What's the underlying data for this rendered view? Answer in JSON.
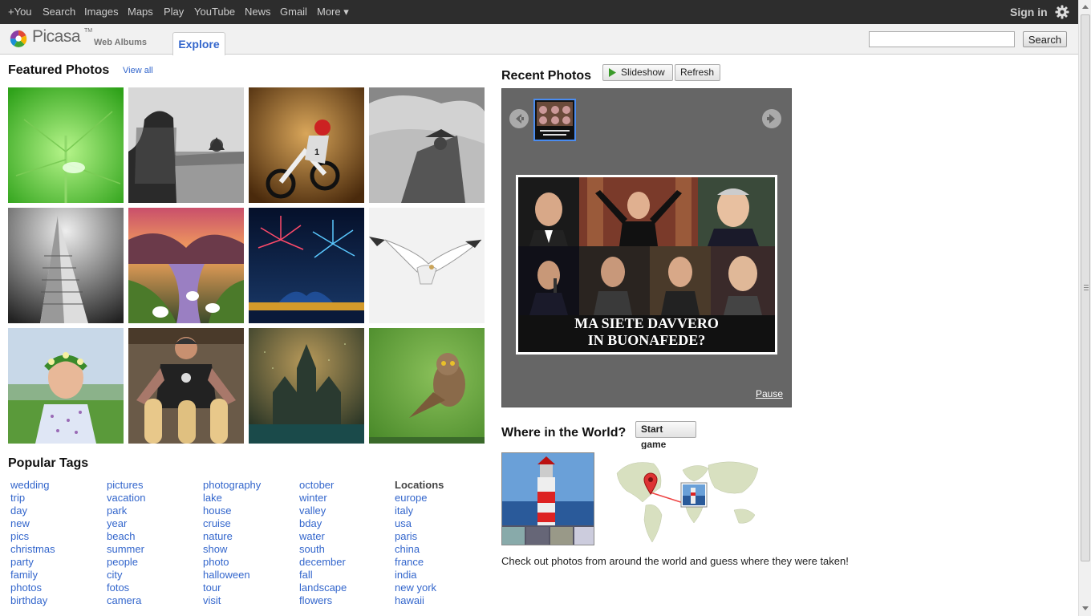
{
  "topbar": {
    "links": [
      "+You",
      "Search",
      "Images",
      "Maps",
      "Play",
      "YouTube",
      "News",
      "Gmail",
      "More ▾"
    ],
    "signin": "Sign in"
  },
  "header": {
    "logo": "Picasa",
    "logo_tm": "TM",
    "subtitle": "Web Albums",
    "tab": "Explore",
    "search_value": "",
    "search_button": "Search"
  },
  "featured": {
    "title": "Featured Photos",
    "view_all": "View all"
  },
  "tags": {
    "title": "Popular Tags",
    "col1": [
      "wedding",
      "trip",
      "day",
      "new",
      "pics",
      "christmas",
      "party",
      "family",
      "photos",
      "birthday"
    ],
    "col2": [
      "pictures",
      "vacation",
      "park",
      "year",
      "beach",
      "summer",
      "people",
      "city",
      "fotos",
      "camera"
    ],
    "col3": [
      "photography",
      "lake",
      "house",
      "cruise",
      "nature",
      "show",
      "photo",
      "halloween",
      "tour",
      "visit"
    ],
    "col4": [
      "october",
      "winter",
      "valley",
      "bday",
      "water",
      "south",
      "december",
      "fall",
      "landscape",
      "flowers"
    ],
    "locations_title": "Locations",
    "col5": [
      "europe",
      "italy",
      "usa",
      "paris",
      "china",
      "france",
      "india",
      "new york",
      "hawaii"
    ]
  },
  "recent": {
    "title": "Recent Photos",
    "slideshow": "Slideshow",
    "refresh": "Refresh",
    "caption_line1": "MA SIETE DAVVERO",
    "caption_line2": "IN BUONAFEDE?",
    "pause": "Pause"
  },
  "world": {
    "title": "Where in the World?",
    "start": "Start game",
    "description": "Check out photos from around the world and guess where they were taken!"
  }
}
